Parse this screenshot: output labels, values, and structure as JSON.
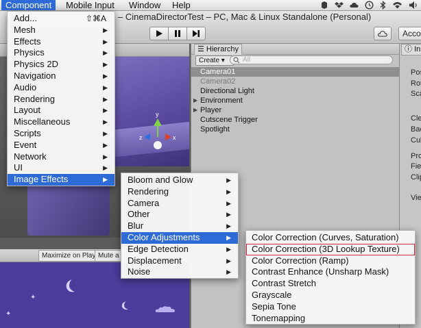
{
  "menubar": {
    "items": [
      "Component",
      "Mobile Input",
      "Window",
      "Help"
    ]
  },
  "window": {
    "title": "– CinemaDirectorTest – PC, Mac & Linux Standalone (Personal)",
    "account_label": "Accou"
  },
  "scene": {
    "game_tab_buttons": {
      "maximize_on_play": "Maximize on Play",
      "mute_audio": "Mute a"
    }
  },
  "hierarchy": {
    "tab_label": "Hierarchy",
    "create_label": "Create",
    "search_placeholder": "All",
    "items": [
      {
        "label": "Camera01",
        "selected": true,
        "disabled": false,
        "expandable": false
      },
      {
        "label": "Camera02",
        "selected": false,
        "disabled": true,
        "expandable": false
      },
      {
        "label": "Directional Light",
        "selected": false,
        "disabled": false,
        "expandable": false
      },
      {
        "label": "Environment",
        "selected": false,
        "disabled": false,
        "expandable": true
      },
      {
        "label": "Player",
        "selected": false,
        "disabled": false,
        "expandable": true
      },
      {
        "label": "Cutscene Trigger",
        "selected": false,
        "disabled": false,
        "expandable": false
      },
      {
        "label": "Spotlight",
        "selected": false,
        "disabled": false,
        "expandable": false
      }
    ]
  },
  "inspector": {
    "tab_label": "In",
    "labels": [
      "Pos",
      "Rot",
      "Sca",
      "Cle",
      "Bac",
      "Cul",
      "Pro",
      "Fiel",
      "Clip",
      "Vie"
    ]
  },
  "component_menu": {
    "items": [
      {
        "label": "Add...",
        "shortcut": "⇧⌘A",
        "has_submenu": false
      },
      {
        "label": "Mesh",
        "has_submenu": true
      },
      {
        "label": "Effects",
        "has_submenu": true
      },
      {
        "label": "Physics",
        "has_submenu": true
      },
      {
        "label": "Physics 2D",
        "has_submenu": true
      },
      {
        "label": "Navigation",
        "has_submenu": true
      },
      {
        "label": "Audio",
        "has_submenu": true
      },
      {
        "label": "Rendering",
        "has_submenu": true
      },
      {
        "label": "Layout",
        "has_submenu": true
      },
      {
        "label": "Miscellaneous",
        "has_submenu": true
      },
      {
        "label": "Scripts",
        "has_submenu": true
      },
      {
        "label": "Event",
        "has_submenu": true
      },
      {
        "label": "Network",
        "has_submenu": true
      },
      {
        "label": "UI",
        "has_submenu": true
      },
      {
        "label": "Image Effects",
        "has_submenu": true,
        "highlighted": true
      }
    ]
  },
  "image_effects_menu": {
    "items": [
      {
        "label": "Bloom and Glow",
        "has_submenu": true
      },
      {
        "label": "Rendering",
        "has_submenu": true
      },
      {
        "label": "Camera",
        "has_submenu": true
      },
      {
        "label": "Other",
        "has_submenu": true
      },
      {
        "label": "Blur",
        "has_submenu": true
      },
      {
        "label": "Color Adjustments",
        "has_submenu": true,
        "highlighted": true
      },
      {
        "label": "Edge Detection",
        "has_submenu": true
      },
      {
        "label": "Displacement",
        "has_submenu": true
      },
      {
        "label": "Noise",
        "has_submenu": true
      }
    ]
  },
  "color_adjustments_menu": {
    "items": [
      {
        "label": "Color Correction (Curves, Saturation)"
      },
      {
        "label": "Color Correction (3D Lookup Texture)",
        "boxed": true
      },
      {
        "label": "Color Correction (Ramp)"
      },
      {
        "label": "Contrast Enhance (Unsharp Mask)"
      },
      {
        "label": "Contrast Stretch"
      },
      {
        "label": "Grayscale"
      },
      {
        "label": "Sepia Tone"
      },
      {
        "label": "Tonemapping"
      }
    ]
  },
  "colors": {
    "menu_highlight": "#2e6bd6",
    "selection_box": "#cc2233",
    "scene_purple": "#5a4aa0"
  }
}
